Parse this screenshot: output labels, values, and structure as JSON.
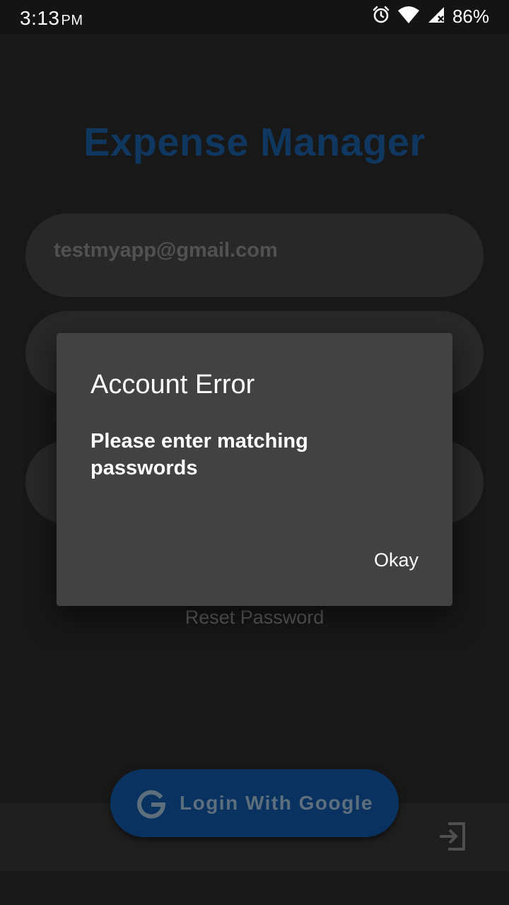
{
  "status_bar": {
    "time": "3:13",
    "ampm": "PM",
    "battery": "86%",
    "icons": [
      "alarm-icon",
      "wifi-icon",
      "cell-signal-icon"
    ]
  },
  "app": {
    "title": "Expense Manager",
    "email_field": {
      "value": "testmyapp@gmail.com"
    },
    "reset_password_label": "Reset Password",
    "google_button_label": "Login With Google",
    "colors": {
      "accent": "#1565c0",
      "title": "#1f6fbf",
      "field": "#515151"
    }
  },
  "dialog": {
    "title": "Account Error",
    "message": "Please enter matching passwords",
    "button_label": "Okay",
    "background": "#424242"
  }
}
